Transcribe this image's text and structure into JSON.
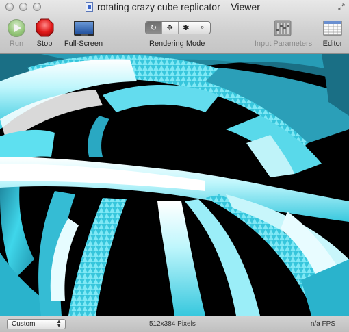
{
  "window": {
    "title": "rotating crazy cube replicator – Viewer"
  },
  "toolbar": {
    "run_label": "Run",
    "stop_label": "Stop",
    "fullscreen_label": "Full-Screen",
    "rendering_mode_label": "Rendering Mode",
    "rendering_modes": [
      {
        "icon": "rotate-icon",
        "glyph": "↻"
      },
      {
        "icon": "move-icon",
        "glyph": "✥"
      },
      {
        "icon": "bug-icon",
        "glyph": "✱"
      },
      {
        "icon": "magnifier-icon",
        "glyph": "⌕"
      }
    ],
    "input_parameters_label": "Input Parameters",
    "editor_label": "Editor"
  },
  "status": {
    "mode_select": "Custom",
    "pixels": "512x384 Pixels",
    "fps": "n/a FPS"
  },
  "colors": {
    "accent_cyan": "#3fd6ea",
    "stop_red": "#d81414",
    "run_green": "#7fc25a"
  }
}
